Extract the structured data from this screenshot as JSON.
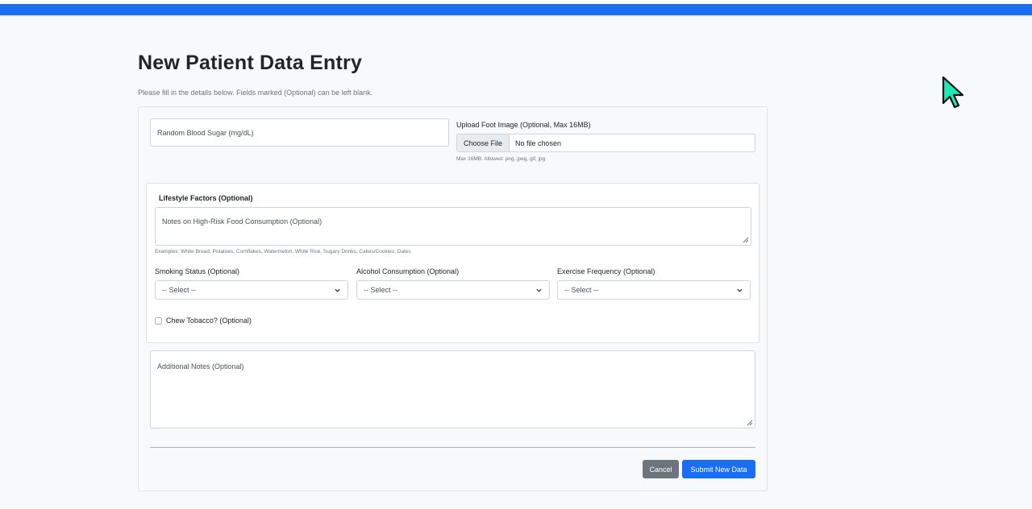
{
  "page": {
    "title": "New Patient Data Entry",
    "subtitle": "Please fill in the details below. Fields marked (Optional) can be left blank."
  },
  "form": {
    "blood_sugar_placeholder": "Random Blood Sugar (mg/dL)",
    "upload": {
      "label": "Upload Foot Image (Optional, Max 16MB)",
      "button_label": "Choose File",
      "status": "No file chosen",
      "help": "Max 16MB. Allowed: png, jpeg, gif, jpg"
    },
    "lifestyle": {
      "title": "Lifestyle Factors (Optional)",
      "food_notes_placeholder": "Notes on High-Risk Food Consumption (Optional)",
      "food_help": "Examples: White Bread, Potatoes, Cornflakes, Watermelon, White Rice, Sugary Drinks, Cakes/Cookies, Dates",
      "smoking": {
        "label": "Smoking Status (Optional)",
        "selected": "-- Select --"
      },
      "alcohol": {
        "label": "Alcohol Consumption (Optional)",
        "selected": "-- Select --"
      },
      "exercise": {
        "label": "Exercise Frequency (Optional)",
        "selected": "-- Select --"
      },
      "tobacco": {
        "label": "Chew Tobacco? (Optional)",
        "checked": false
      }
    },
    "additional_notes_placeholder": "Additional Notes (Optional)"
  },
  "actions": {
    "cancel_label": "Cancel",
    "submit_label": "Submit New Data"
  },
  "colors": {
    "primary": "#1a6ef5",
    "secondary": "#6c757d",
    "cursor": "#1de9b6"
  },
  "icons": {
    "select_arrow": "chevron-down-icon",
    "textarea_resize": "resize-handle-icon",
    "mouse_cursor": "cursor-icon"
  }
}
